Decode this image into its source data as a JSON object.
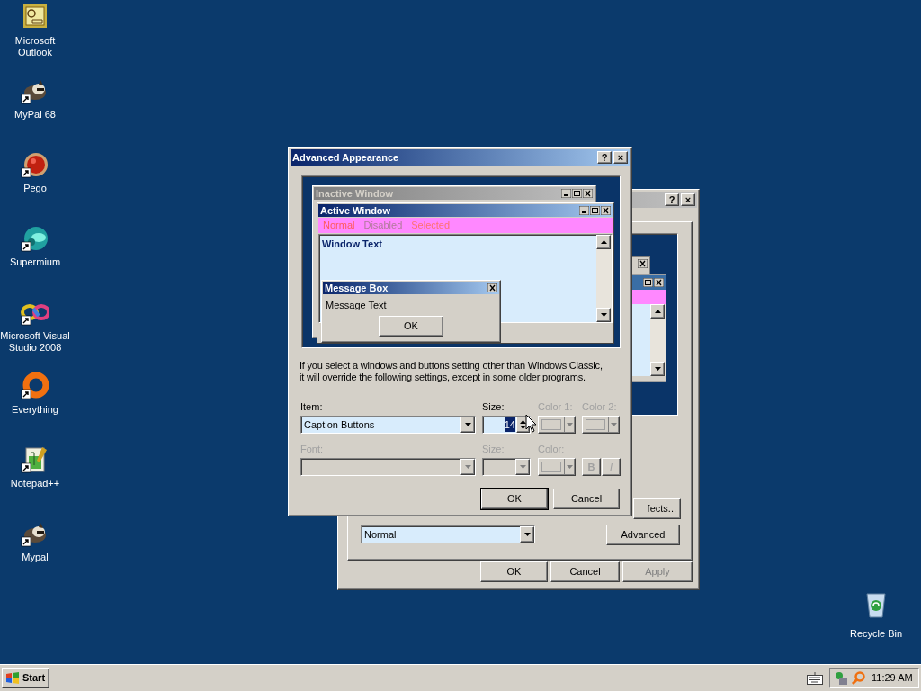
{
  "desktop": {
    "icons": [
      {
        "label": "Microsoft\nOutlook",
        "shortcut": false
      },
      {
        "label": "MyPal 68",
        "shortcut": true
      },
      {
        "label": "Pego",
        "shortcut": true
      },
      {
        "label": "Supermium",
        "shortcut": true
      },
      {
        "label": "Microsoft Visual\nStudio 2008",
        "shortcut": true
      },
      {
        "label": "Everything",
        "shortcut": true
      },
      {
        "label": "Notepad++",
        "shortcut": true
      },
      {
        "label": "Mypal",
        "shortcut": true
      }
    ],
    "recycle_bin": {
      "label": "Recycle Bin"
    }
  },
  "back_window": {
    "title_buttons": [
      "?",
      "×"
    ],
    "effects_button": "fects...",
    "font_size": {
      "value": "Normal"
    },
    "advanced_button": "Advanced",
    "buttons": [
      {
        "label": "OK",
        "disabled": false
      },
      {
        "label": "Cancel",
        "disabled": false
      },
      {
        "label": "Apply",
        "disabled": true
      }
    ]
  },
  "dialog": {
    "title": "Advanced Appearance",
    "title_buttons": [
      "?",
      "×"
    ],
    "preview": {
      "inactive_window": {
        "title": "Inactive Window"
      },
      "active_window": {
        "title": "Active Window",
        "menu": [
          {
            "label": "Normal",
            "kind": "normal"
          },
          {
            "label": "Disabled",
            "kind": "disabled"
          },
          {
            "label": "Selected",
            "kind": "selected"
          }
        ],
        "text": "Window Text"
      },
      "message_box": {
        "title": "Message Box",
        "text": "Message Text",
        "button": "OK"
      }
    },
    "note": "If you select a windows and buttons setting other than Windows Classic,\nit will override the following settings, except in some older programs.",
    "row1": [
      {
        "label": "Item:",
        "value": "Caption Buttons",
        "kind": "dropdown",
        "disabled": false
      },
      {
        "label": "Size:",
        "value": "14",
        "kind": "spinner",
        "disabled": false,
        "text_selected": true
      },
      {
        "label": "Color 1:",
        "kind": "color",
        "disabled": true
      },
      {
        "label": "Color 2:",
        "kind": "color",
        "disabled": true
      }
    ],
    "row2": [
      {
        "label": "Font:",
        "kind": "dropdown",
        "disabled": true
      },
      {
        "label": "Size:",
        "kind": "dropdown",
        "disabled": true
      },
      {
        "label": "Color:",
        "kind": "color",
        "disabled": true
      }
    ],
    "style_buttons": [
      {
        "label": "B",
        "disabled": true
      },
      {
        "label": "I",
        "disabled": true
      }
    ],
    "buttons": [
      {
        "label": "OK",
        "default": true
      },
      {
        "label": "Cancel",
        "default": false
      }
    ]
  },
  "taskbar": {
    "start": "Start",
    "clock": "11:29 AM"
  }
}
